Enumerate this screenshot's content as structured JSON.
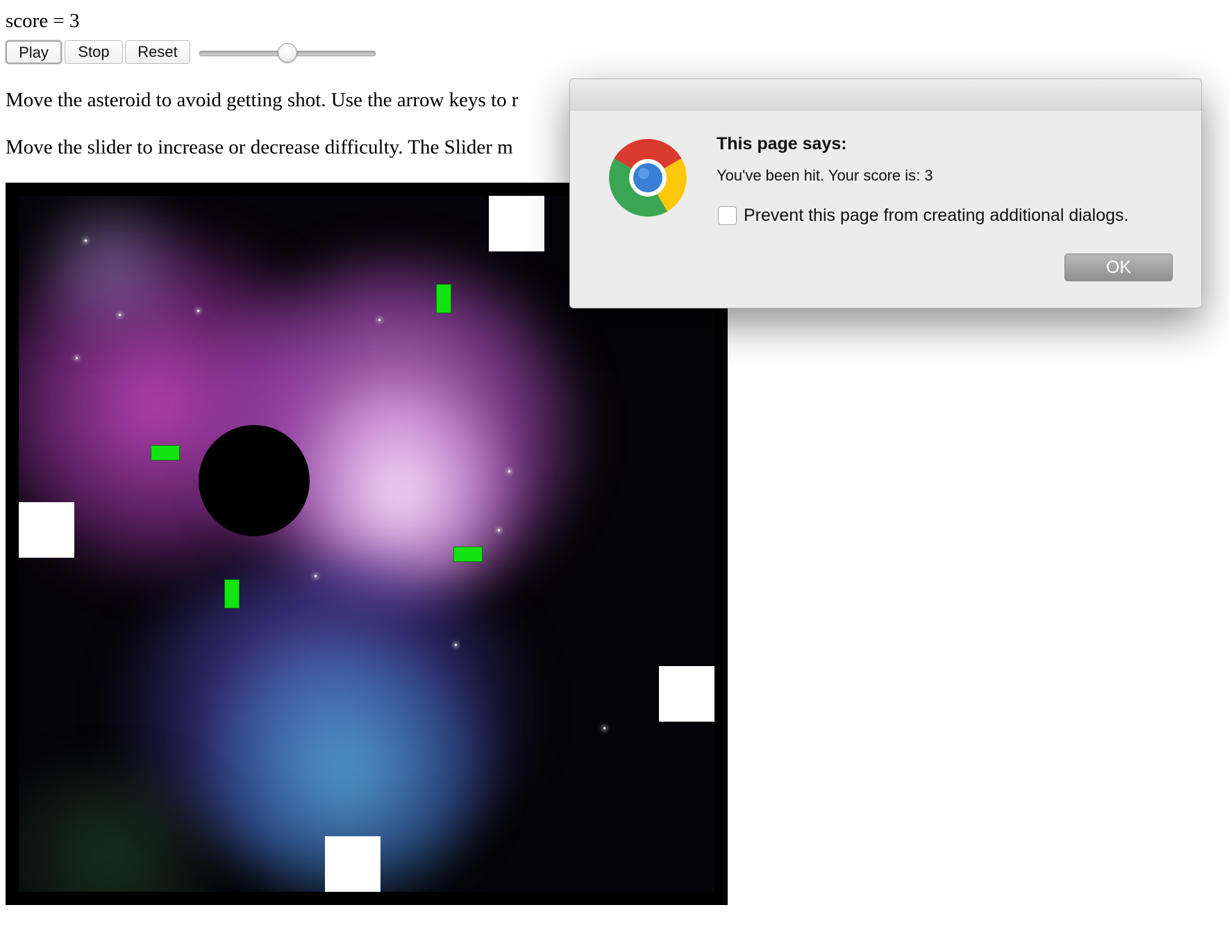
{
  "score": {
    "text": "score = 3"
  },
  "controls": {
    "play_label": "Play",
    "stop_label": "Stop",
    "reset_label": "Reset",
    "difficulty_slider_value_fraction": 0.5
  },
  "instructions": {
    "line1": "Move the asteroid to avoid getting shot. Use the arrow keys to r",
    "line2": "Move the slider to increase or decrease difficulty. The Slider m"
  },
  "game": {
    "background": "space nebula",
    "asteroid_color": "#000000",
    "bullet_color": "#11e411",
    "shooter_color": "#ffffff"
  },
  "dialog": {
    "icon": "chrome-logo-icon",
    "heading": "This page says:",
    "message": "You've been hit. Your score is: 3",
    "checkbox_label": "Prevent this page from creating additional dialogs.",
    "checkbox_checked": false,
    "ok_label": "OK"
  }
}
